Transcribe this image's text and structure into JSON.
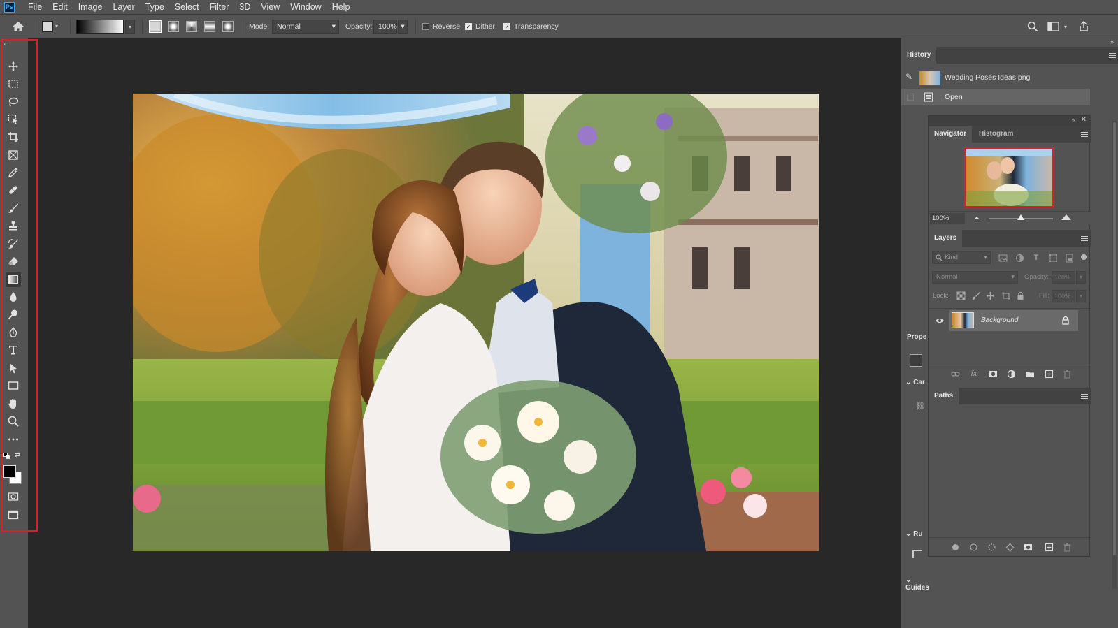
{
  "app": {
    "logo": "Ps"
  },
  "menu": [
    "File",
    "Edit",
    "Image",
    "Layer",
    "Type",
    "Select",
    "Filter",
    "3D",
    "View",
    "Window",
    "Help"
  ],
  "options": {
    "mode_label": "Mode:",
    "mode_value": "Normal",
    "opacity_label": "Opacity:",
    "opacity_value": "100%",
    "reverse_label": "Reverse",
    "dither_label": "Dither",
    "transparency_label": "Transparency",
    "reverse_checked": false,
    "dither_checked": true,
    "transparency_checked": true
  },
  "history": {
    "tab": "History",
    "snapshot": "Wedding Poses Ideas.png",
    "items": [
      "Open"
    ]
  },
  "navigator": {
    "tabs": [
      "Navigator",
      "Histogram"
    ],
    "zoom": "100%"
  },
  "layers": {
    "tab": "Layers",
    "filter_placeholder": "Kind",
    "blend_mode": "Normal",
    "opacity_label": "Opacity:",
    "opacity_value": "100%",
    "lock_label": "Lock:",
    "fill_label": "Fill:",
    "fill_value": "100%",
    "layer_name": "Background"
  },
  "properties": {
    "tab": "Prope",
    "section_canvas": "Car",
    "section_rulers": "Ru",
    "section_guides": "Guides"
  },
  "paths": {
    "tab": "Paths"
  },
  "colors": {
    "highlight": "#e31b23",
    "foreground": "#000000",
    "background": "#ffffff",
    "accent_blue": "#31a8ff"
  },
  "icons": [
    "home-icon",
    "move-icon",
    "marquee-icon",
    "lasso-icon",
    "object-select-icon",
    "crop-icon",
    "frame-icon",
    "eyedropper-icon",
    "healing-icon",
    "brush-icon",
    "stamp-icon",
    "history-brush-icon",
    "eraser-icon",
    "gradient-icon",
    "blur-icon",
    "dodge-icon",
    "pen-icon",
    "type-icon",
    "path-select-icon",
    "rectangle-icon",
    "hand-icon",
    "zoom-icon",
    "more-icon",
    "search-icon",
    "workspace-icon",
    "share-icon"
  ]
}
